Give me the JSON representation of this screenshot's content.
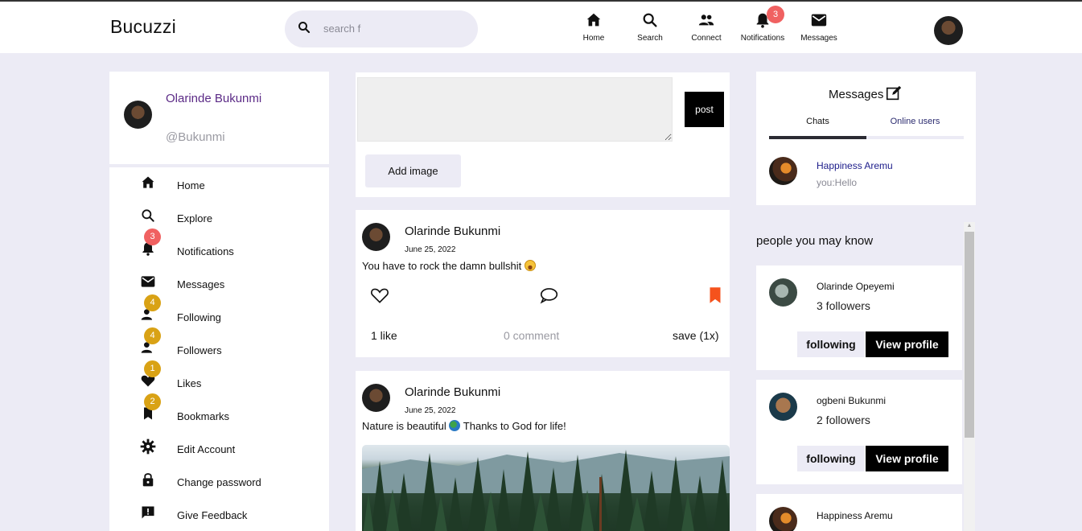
{
  "app": {
    "title": "Bucuzzi"
  },
  "search": {
    "placeholder": "search f"
  },
  "topnav": [
    {
      "label": "Home",
      "icon": "home-icon"
    },
    {
      "label": "Search",
      "icon": "search-icon"
    },
    {
      "label": "Connect",
      "icon": "people-icon"
    },
    {
      "label": "Notifications",
      "icon": "bell-icon",
      "badge": "3"
    },
    {
      "label": "Messages",
      "icon": "mail-icon"
    }
  ],
  "profile": {
    "name": "Olarinde Bukunmi",
    "handle": "@Bukunmi"
  },
  "sidebar": {
    "items": [
      {
        "label": "Home",
        "icon": "home-icon"
      },
      {
        "label": "Explore",
        "icon": "search-icon"
      },
      {
        "label": "Notifications",
        "icon": "bell-icon",
        "badge": "3",
        "badge_color": "#f06161"
      },
      {
        "label": "Messages",
        "icon": "mail-icon"
      },
      {
        "label": "Following",
        "icon": "person-icon",
        "badge": "4",
        "badge_color": "#d9a215"
      },
      {
        "label": "Followers",
        "icon": "person-icon",
        "badge": "4",
        "badge_color": "#d9a215"
      },
      {
        "label": "Likes",
        "icon": "heart-icon",
        "badge": "1",
        "badge_color": "#d9a215"
      },
      {
        "label": "Bookmarks",
        "icon": "bookmark-icon",
        "badge": "2",
        "badge_color": "#d9a215"
      },
      {
        "label": "Edit Account",
        "icon": "gear-icon"
      },
      {
        "label": "Change password",
        "icon": "lock-icon"
      },
      {
        "label": "Give Feedback",
        "icon": "feedback-icon"
      }
    ]
  },
  "composer": {
    "post_label": "post",
    "add_image_label": "Add image"
  },
  "posts": [
    {
      "author": "Olarinde Bukunmi",
      "date": "June 25, 2022",
      "text": "You have to rock the damn bullshit",
      "likes": "1 like",
      "comments": "0 comment",
      "saves": "save (1x)",
      "bookmark_color": "#f5521c"
    },
    {
      "author": "Olarinde Bukunmi",
      "date": "June 25, 2022",
      "text_before": "Nature is beautiful",
      "text_after": "Thanks to God for life!"
    }
  ],
  "messages": {
    "title": "Messages",
    "tabs": [
      "Chats",
      "Online users"
    ],
    "chats": [
      {
        "name": "Happiness Aremu",
        "last": "you:Hello"
      }
    ]
  },
  "suggestions": {
    "title": "people you may know",
    "people": [
      {
        "name": "Olarinde Opeyemi",
        "followers": "3 followers",
        "follow_label": "following",
        "view_label": "View profile"
      },
      {
        "name": "ogbeni Bukunmi",
        "followers": "2 followers",
        "follow_label": "following",
        "view_label": "View profile"
      },
      {
        "name": "Happiness Aremu"
      }
    ]
  },
  "colors": {
    "accent": "#5b2a86",
    "badge_red": "#f06161",
    "badge_gold": "#d9a215",
    "bookmark": "#f5521c",
    "background": "#ecebf5"
  }
}
